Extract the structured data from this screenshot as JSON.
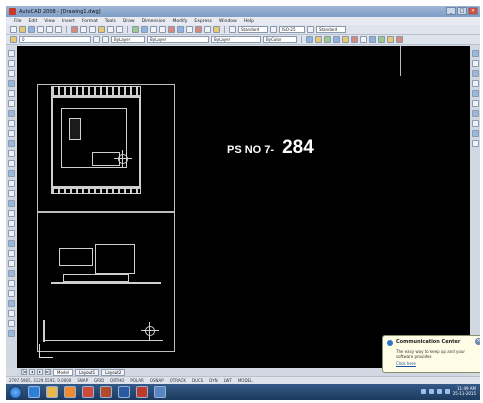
{
  "window": {
    "title": "AutoCAD 2008 - [Drawing1.dwg]",
    "controls": [
      "_",
      "□",
      "×"
    ]
  },
  "menubar": {
    "items": [
      "File",
      "Edit",
      "View",
      "Insert",
      "Format",
      "Tools",
      "Draw",
      "Dimension",
      "Modify",
      "Express",
      "Window",
      "Help"
    ]
  },
  "toolbar": {
    "style_combo": "Standard",
    "dim_combo": "ISO-25",
    "table_combo": "Standard",
    "layer_combo": "0",
    "color_combo": "ByLayer",
    "linetype_combo": "ByLayer",
    "lineweight_combo": "ByLayer",
    "plotstyle_combo": "ByColor"
  },
  "drawing": {
    "label_prefix": "PS NO 7-",
    "label_number": "284"
  },
  "layout_tabs": {
    "nav": [
      "|◂",
      "◂",
      "▸",
      "▸|"
    ],
    "tabs": [
      "Model",
      "Layout1",
      "Layout2"
    ],
    "active": "Model"
  },
  "statusbar": {
    "coords": "2797.5965, 3129.5592, 0.0000",
    "toggles": [
      "SNAP",
      "GRID",
      "ORTHO",
      "POLAR",
      "OSNAP",
      "OTRACK",
      "DUCS",
      "DYN",
      "LWT",
      "MODEL"
    ]
  },
  "notification": {
    "title": "Communication Center",
    "text": "The easy way to keep up and your software provides",
    "link": "Click here"
  },
  "taskbar": {
    "clock_time": "11:49 AM",
    "clock_date": "25-11-2015"
  }
}
